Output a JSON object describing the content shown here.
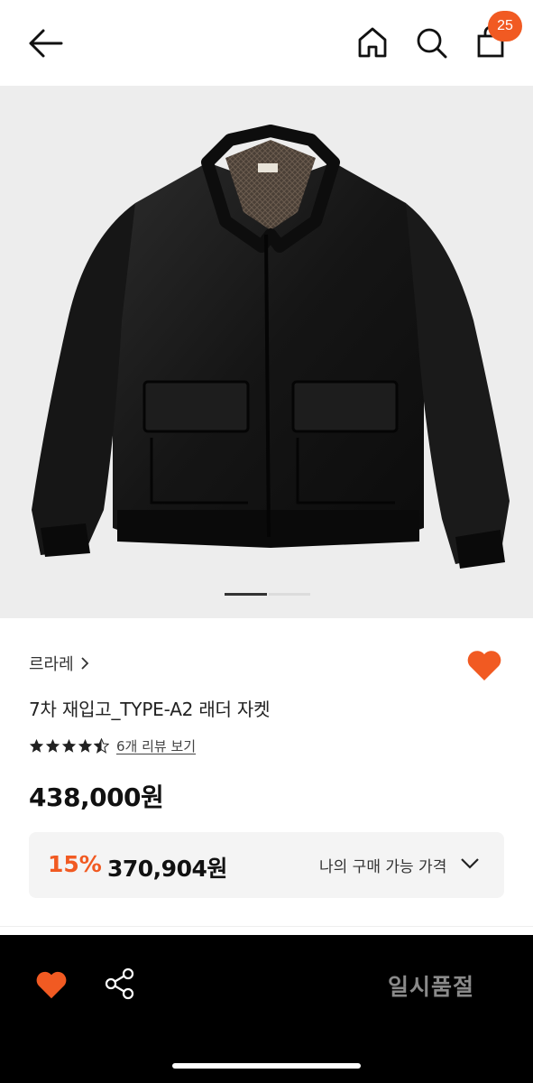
{
  "header": {
    "back_icon": "arrow-left-icon",
    "home_icon": "home-icon",
    "search_icon": "search-icon",
    "bag_icon": "shopping-bag-icon",
    "cart_count": "25"
  },
  "gallery": {
    "image": "black leather bomber jacket with quilted collar lining",
    "current_index": 1,
    "total": 2
  },
  "product": {
    "brand": "르라레",
    "title": "7차 재입고_TYPE-A2 래더 자켓",
    "rating": 4.5,
    "review_link": "6개 리뷰 보기",
    "price": "438,000원",
    "liked": true
  },
  "benefit": {
    "discount": "15%",
    "price": "370,904원",
    "label": "나의 구매 가능 가격"
  },
  "bottom_bar": {
    "like_icon": "heart-icon",
    "share_icon": "share-icon",
    "status": "일시품절"
  },
  "colors": {
    "accent": "#f15a22",
    "bottom_bar_bg": "#000000",
    "disabled_text": "#8a8a8a",
    "benefit_bg": "#f4f4f4"
  }
}
